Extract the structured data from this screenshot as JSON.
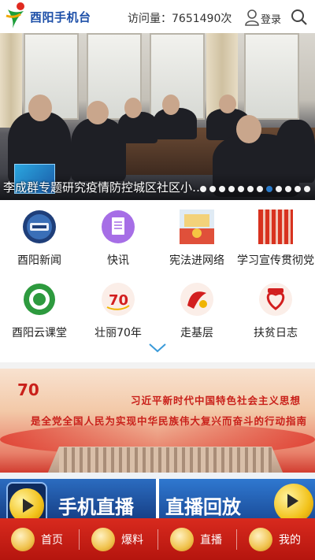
{
  "header": {
    "app_title": "酉阳手机台",
    "visits": "访问量：7651490次",
    "login_label": "登录"
  },
  "banner": {
    "caption": "李成群专题研究疫情防控城区社区小…",
    "slide_count": 12,
    "active_index": 7
  },
  "grid": {
    "items": [
      {
        "label": "酉阳新闻",
        "icon": "youyang-news-icon"
      },
      {
        "label": "快讯",
        "icon": "document-icon"
      },
      {
        "label": "宪法进网络",
        "icon": "constitution-icon"
      },
      {
        "label": "学习宣传贯彻党",
        "icon": "study-icon"
      },
      {
        "label": "酉阳云课堂",
        "icon": "cloud-classroom-icon"
      },
      {
        "label": "壮丽70年",
        "icon": "70-years-icon"
      },
      {
        "label": "走基层",
        "icon": "grassroots-icon"
      },
      {
        "label": "扶贫日志",
        "icon": "poverty-alleviation-icon"
      }
    ]
  },
  "promo": {
    "line1": "习近平新时代中国特色社会主义思想",
    "line2": "是全党全国人民为实现中华民族伟大复兴而奋斗的行动指南"
  },
  "live": {
    "left_label": "手机直播",
    "right_label": "直播回放"
  },
  "tabbar": {
    "items": [
      {
        "label": "首页",
        "icon": "home-knot-icon"
      },
      {
        "label": "爆料",
        "icon": "tip-off-icon"
      },
      {
        "label": "直播",
        "icon": "live-icon"
      },
      {
        "label": "我的",
        "icon": "profile-icon"
      }
    ]
  },
  "colors": {
    "brand_blue": "#1d4fa8",
    "tab_red": "#c81f15",
    "indicator_active": "#2a7fd4"
  }
}
